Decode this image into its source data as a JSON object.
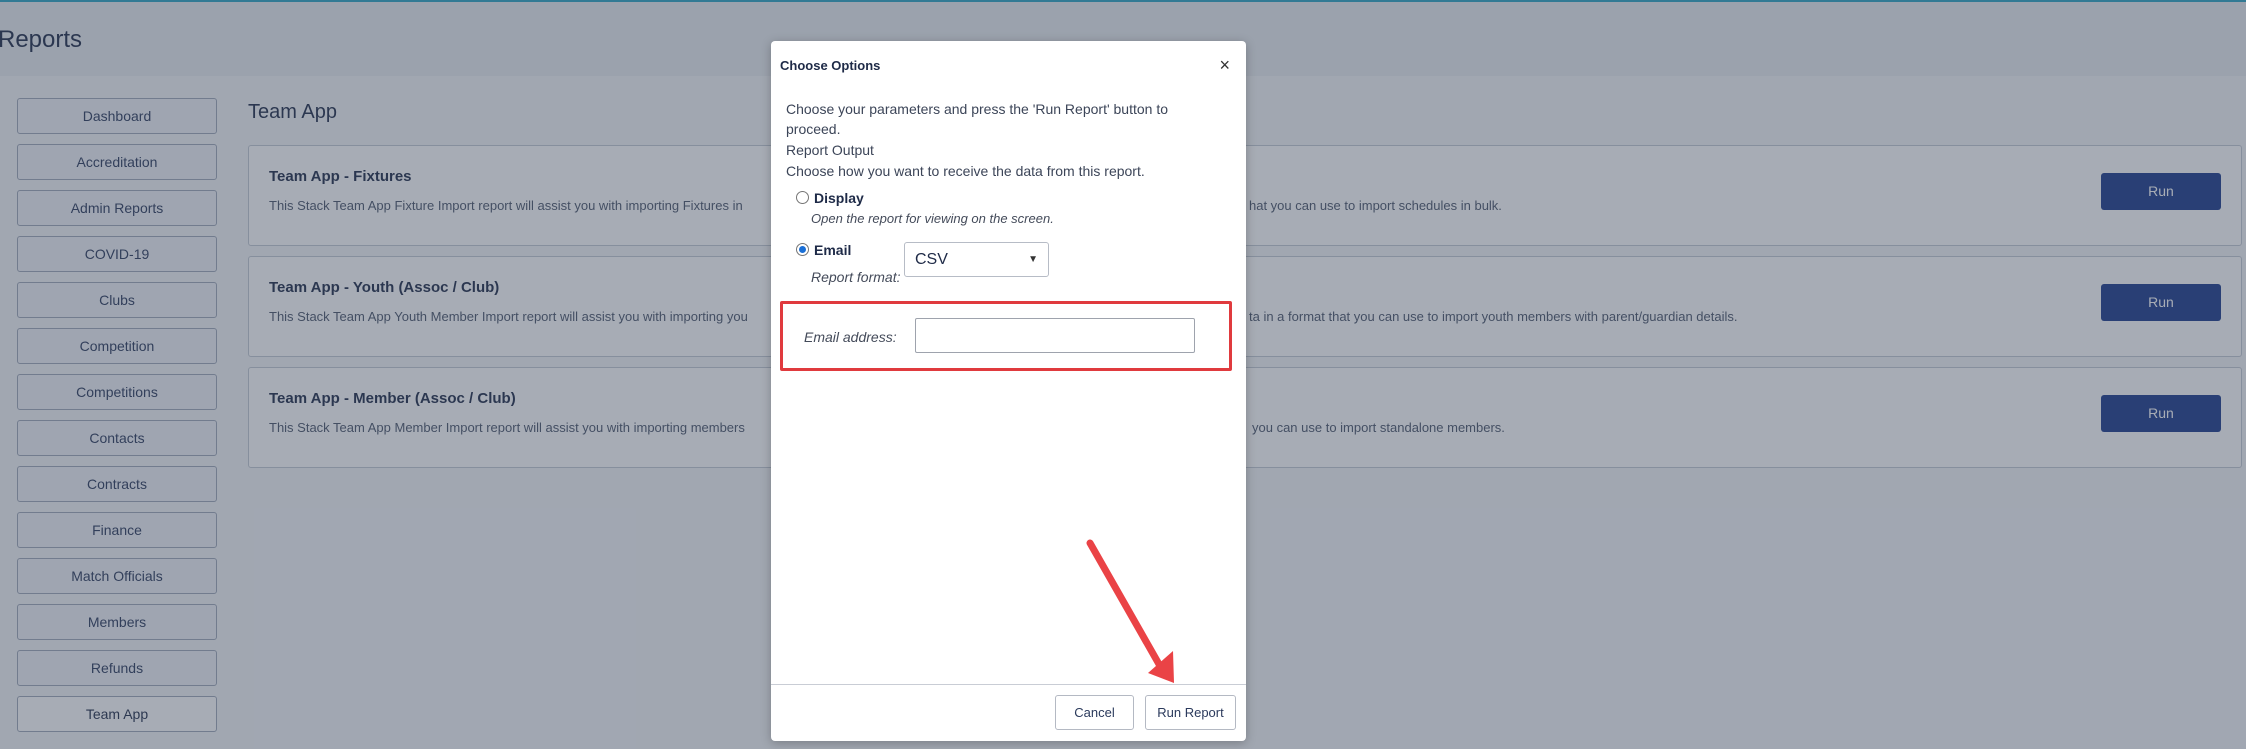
{
  "page": {
    "title": "Reports"
  },
  "sidebar": {
    "items": [
      {
        "label": "Dashboard"
      },
      {
        "label": "Accreditation"
      },
      {
        "label": "Admin Reports"
      },
      {
        "label": "COVID-19"
      },
      {
        "label": "Clubs"
      },
      {
        "label": "Competition"
      },
      {
        "label": "Competitions"
      },
      {
        "label": "Contacts"
      },
      {
        "label": "Contracts"
      },
      {
        "label": "Finance"
      },
      {
        "label": "Match Officials"
      },
      {
        "label": "Members"
      },
      {
        "label": "Refunds"
      },
      {
        "label": "Team App"
      }
    ]
  },
  "main": {
    "section_title": "Team App",
    "cards": [
      {
        "title": "Team App - Fixtures",
        "desc_left": "This Stack Team App Fixture Import report will assist you with importing Fixtures in",
        "desc_right": "hat you can use to import schedules in bulk.",
        "run_label": "Run"
      },
      {
        "title": "Team App - Youth (Assoc / Club)",
        "desc_left": "This Stack Team App Youth Member Import report will assist you with importing you",
        "desc_right": "ta in a format that you can use to import youth members with parent/guardian details.",
        "run_label": "Run"
      },
      {
        "title": "Team App - Member (Assoc / Club)",
        "desc_left": "This Stack Team App Member Import report will assist you with importing members",
        "desc_right": "you can use to import standalone members.",
        "run_label": "Run"
      }
    ]
  },
  "modal": {
    "title": "Choose Options",
    "close_symbol": "×",
    "intro_line1": "Choose your parameters and press the 'Run Report' button to",
    "intro_line2": "proceed.",
    "output_heading": "Report Output",
    "output_desc": "Choose how you want to receive the data from this report.",
    "option_display": "Display",
    "option_display_desc": "Open the report for viewing on the screen.",
    "option_email": "Email",
    "selected_option": "Email",
    "report_format_label": "Report format:",
    "report_format_value": "CSV",
    "email_label": "Email address:",
    "email_value": "",
    "cancel_label": "Cancel",
    "run_report_label": "Run Report"
  },
  "colors": {
    "accent": "#1b3a8a",
    "highlight": "#e03a3e",
    "arrow": "#ea4346"
  }
}
